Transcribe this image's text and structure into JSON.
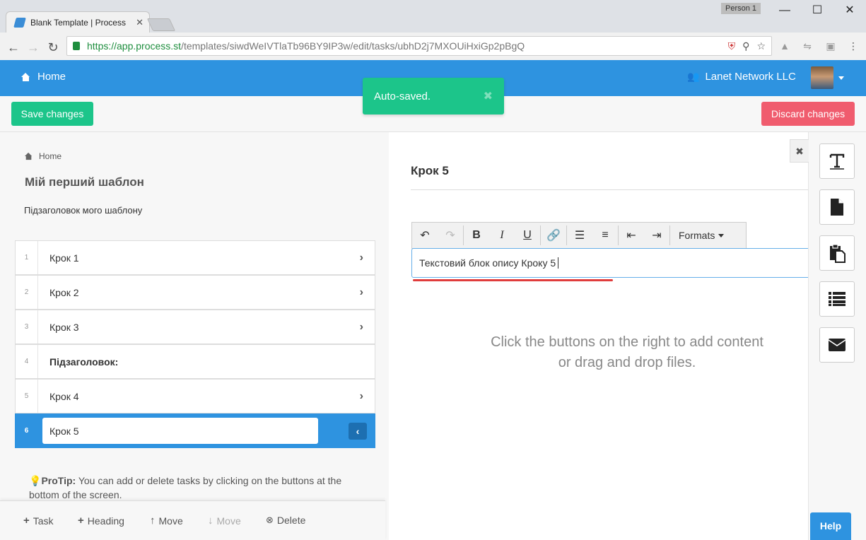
{
  "browser": {
    "tab_title": "Blank Template | Process",
    "tab_close": "✕",
    "profile_label": "Person 1",
    "window_controls": {
      "minimize": "—",
      "maximize": "☐",
      "close": "✕"
    },
    "url_host": "https://app.process.st",
    "url_path": "/templates/siwdWeIVTlaTb96BY9IP3w/edit/tasks/ubhD2j7MXOUiHxiGp2pBgQ"
  },
  "header": {
    "home_label": "Home",
    "org_name": "Lanet Network LLC"
  },
  "toast": {
    "message": "Auto-saved.",
    "close": "✖"
  },
  "actions": {
    "save_label": "Save changes",
    "discard_label": "Discard changes"
  },
  "sidebar": {
    "breadcrumb": "Home",
    "template_title": "Мій перший шаблон",
    "template_subtitle": "Підзаголовок мого шаблону",
    "tasks": [
      {
        "num": "1",
        "name": "Крок 1",
        "type": "task"
      },
      {
        "num": "2",
        "name": "Крок 2",
        "type": "task"
      },
      {
        "num": "3",
        "name": "Крок 3",
        "type": "task"
      },
      {
        "num": "4",
        "name": "Підзаголовок:",
        "type": "heading"
      },
      {
        "num": "5",
        "name": "Крок 4",
        "type": "task"
      },
      {
        "num": "6",
        "name": "Крок 5",
        "type": "active"
      }
    ],
    "protip_label": "ProTip:",
    "protip_text": " You can add or delete tasks by clicking on the buttons at the bottom of the screen.",
    "bottom_actions": {
      "task": "Task",
      "heading": "Heading",
      "move_up": "Move",
      "move_down": "Move",
      "delete": "Delete"
    }
  },
  "editor": {
    "step_title": "Крок 5",
    "formats_label": "Formats",
    "body_text": "Текстовий блок опису Кроку 5",
    "hint_line1": "Click the buttons on the right to add content",
    "hint_line2": "or drag and drop files."
  },
  "rail": {
    "close": "✖",
    "help_label": "Help"
  },
  "colors": {
    "primary": "#2e93e0",
    "success": "#1cc58a",
    "danger": "#f05c6e"
  }
}
